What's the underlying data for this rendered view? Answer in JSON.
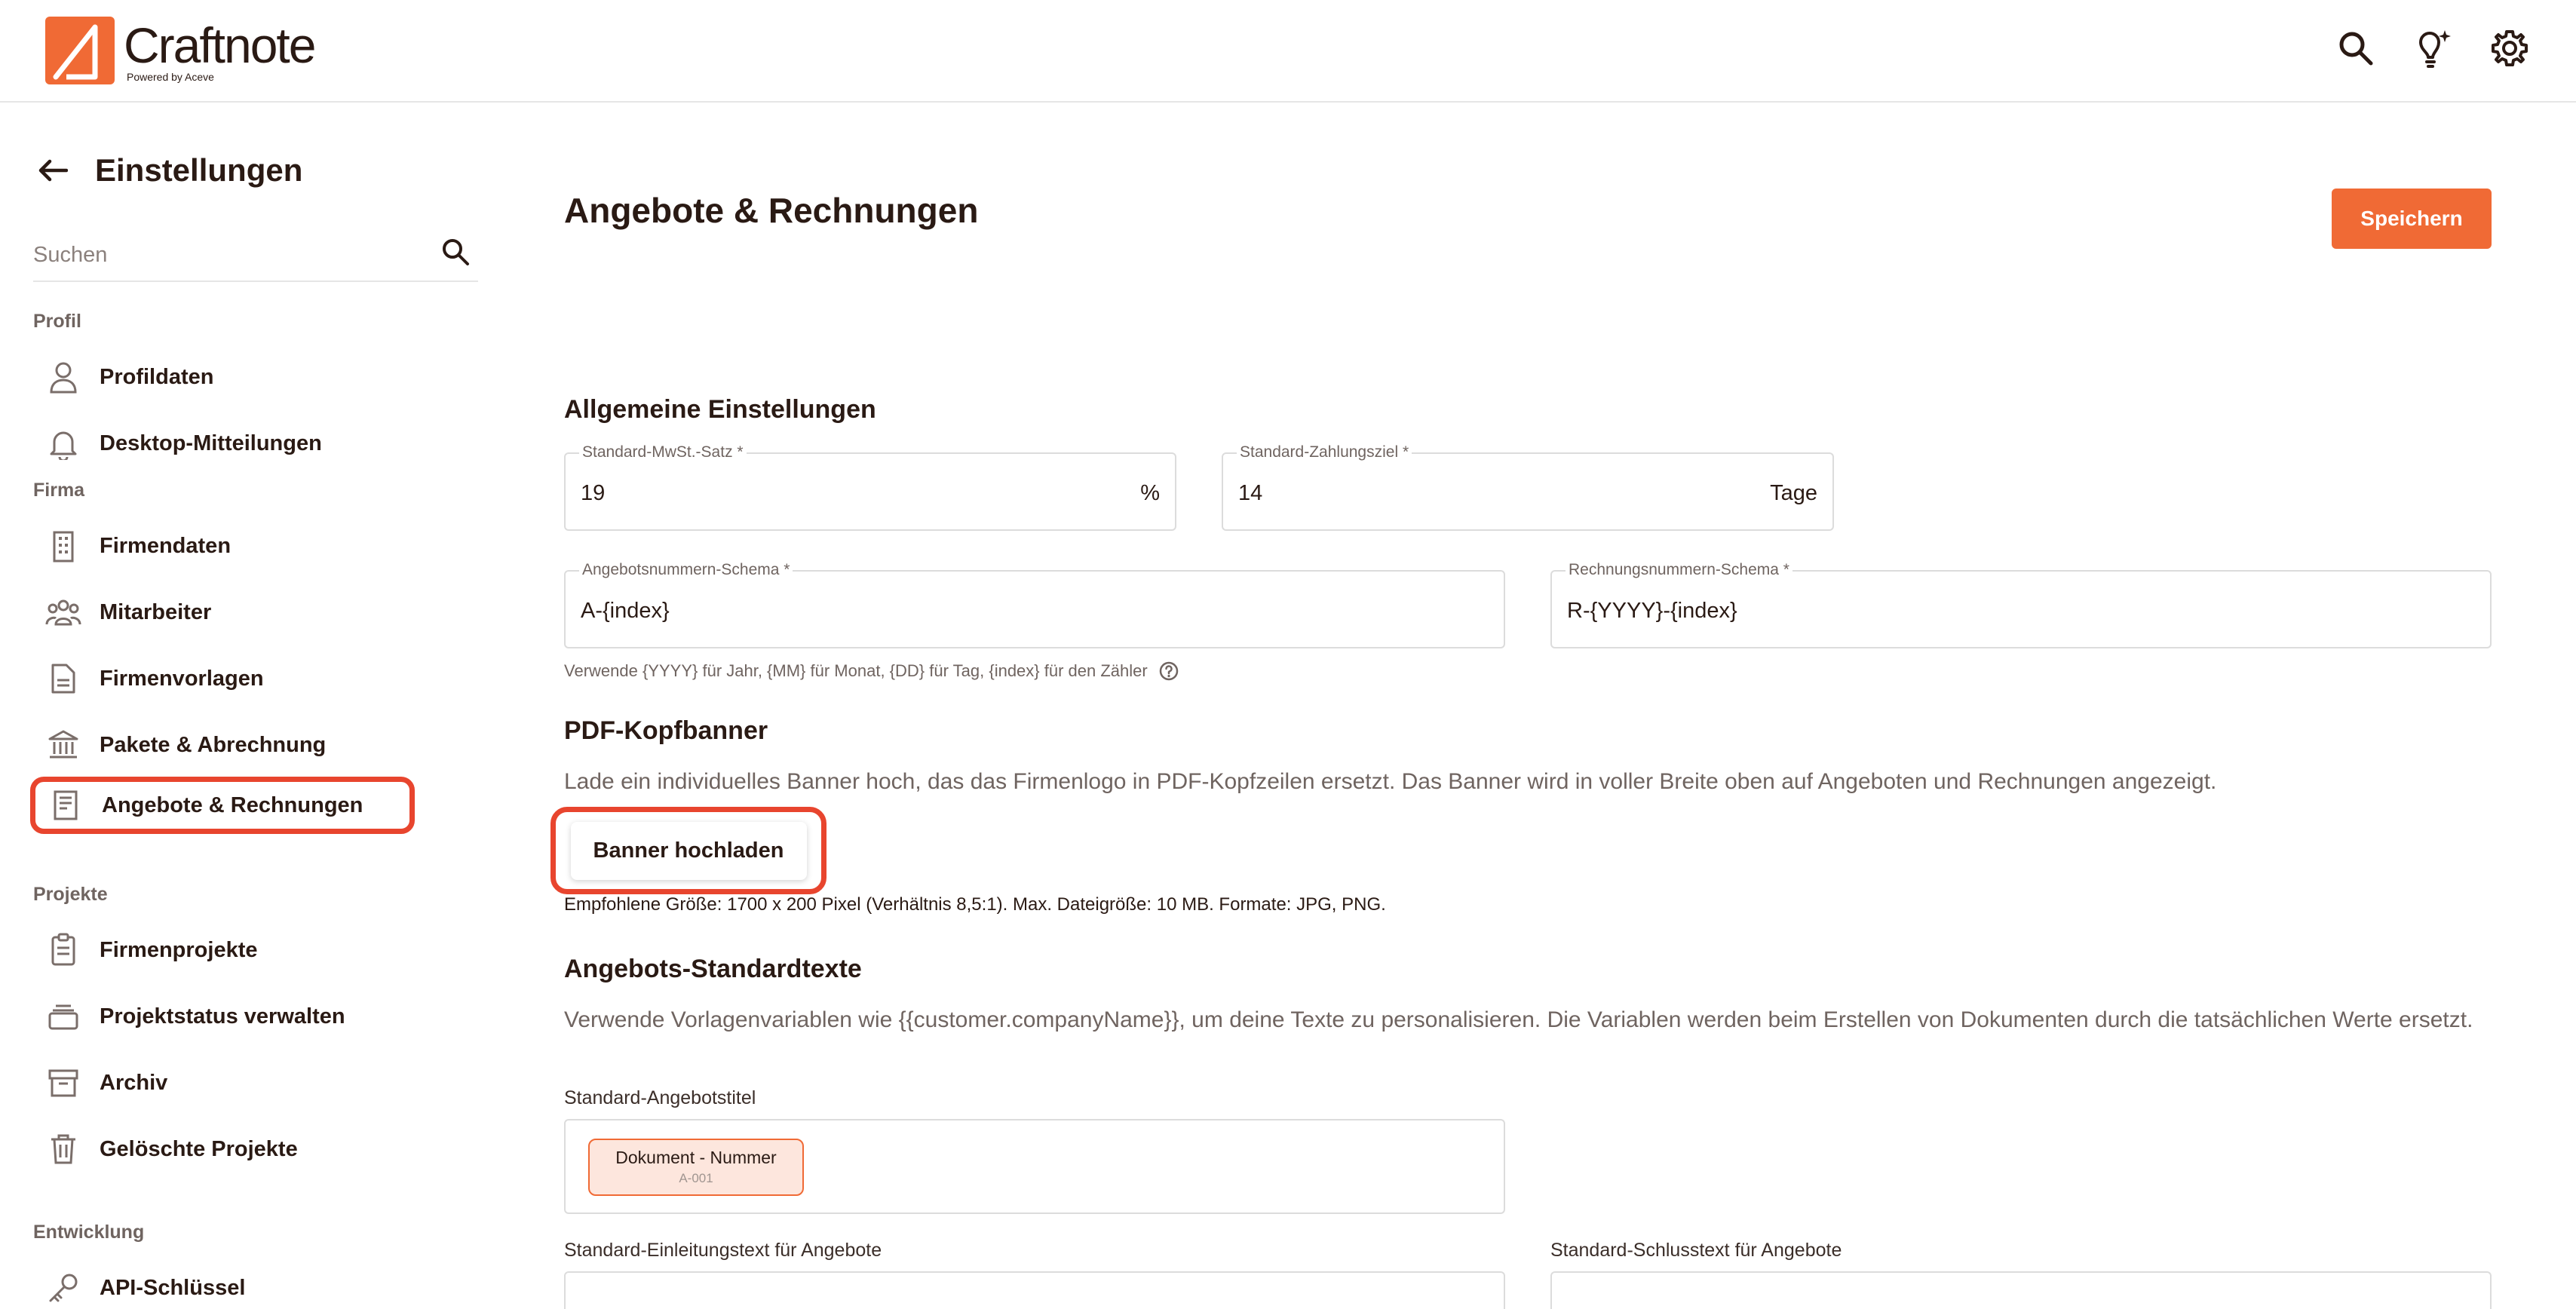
{
  "header": {
    "brand_name": "Craftnote",
    "brand_sub": "Powered by Aceve",
    "icons": [
      "search-icon",
      "lightbulb-sparkle-icon",
      "gear-icon"
    ]
  },
  "sidebar": {
    "back_title": "Einstellungen",
    "search_placeholder": "Suchen",
    "sections": {
      "profil": "Profil",
      "firma": "Firma",
      "projekte": "Projekte",
      "entwicklung": "Entwicklung"
    },
    "items": {
      "profildaten": "Profildaten",
      "desktop": "Desktop-Mitteilungen",
      "firmendaten": "Firmendaten",
      "mitarbeiter": "Mitarbeiter",
      "firmenvorlagen": "Firmenvorlagen",
      "pakete": "Pakete & Abrechnung",
      "angebote": "Angebote & Rechnungen",
      "firmenprojekte": "Firmenprojekte",
      "projektstatus": "Projektstatus verwalten",
      "archiv": "Archiv",
      "geloeschte": "Gelöschte Projekte",
      "api": "API-Schlüssel"
    },
    "active_item": "Angebote & Rechnungen"
  },
  "main": {
    "title": "Angebote & Rechnungen",
    "save_label": "Speichern",
    "general": {
      "heading": "Allgemeine Einstellungen",
      "vat_label": "Standard-MwSt.-Satz *",
      "vat_value": "19",
      "vat_suffix": "%",
      "payment_label": "Standard-Zahlungsziel *",
      "payment_value": "14",
      "payment_suffix": "Tage",
      "offer_schema_label": "Angebotsnummern-Schema *",
      "offer_schema_value": "A-{index}",
      "invoice_schema_label": "Rechnungsnummern-Schema *",
      "invoice_schema_value": "R-{YYYY}-{index}",
      "hint": "Verwende {YYYY} für Jahr, {MM} für Monat, {DD} für Tag, {index} für den Zähler"
    },
    "banner": {
      "heading": "PDF-Kopfbanner",
      "description": "Lade ein individuelles Banner hoch, das das Firmenlogo in PDF-Kopfzeilen ersetzt. Das Banner wird in voller Breite oben auf Angeboten und Rechnungen angezeigt.",
      "upload_label": "Banner hochladen",
      "recommendation": "Empfohlene Größe: 1700 x 200 Pixel (Verhältnis 8,5:1). Max. Dateigröße: 10 MB. Formate: JPG, PNG."
    },
    "texts": {
      "heading": "Angebots-Standardtexte",
      "description": "Verwende Vorlagenvariablen wie {{customer.companyName}}, um deine Texte zu personalisieren. Die Variablen werden beim Erstellen von Dokumenten durch die tatsächlichen Werte ersetzt.",
      "title_label": "Standard-Angebotstitel",
      "chip_title": "Dokument - Nummer",
      "chip_sub": "A-001",
      "intro_label": "Standard-Einleitungstext für Angebote",
      "closing_label": "Standard-Schlusstext für Angebote"
    }
  }
}
